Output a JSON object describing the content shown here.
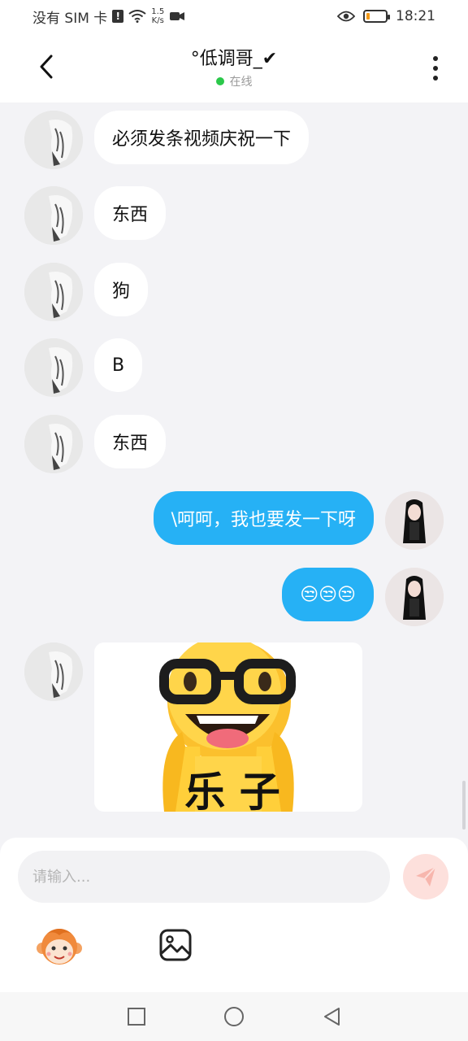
{
  "status_bar": {
    "carrier": "没有 SIM 卡",
    "sim_badge": "!",
    "speed_value": "1.5",
    "speed_unit": "K/s",
    "time": "18:21",
    "battery_level": 0.2
  },
  "header": {
    "title": "°低调哥_✔",
    "status": "在线"
  },
  "messages": [
    {
      "side": "in",
      "text": "必须发条视频庆祝一下"
    },
    {
      "side": "in",
      "text": "东西"
    },
    {
      "side": "in",
      "text": "狗"
    },
    {
      "side": "in",
      "text": "B"
    },
    {
      "side": "in",
      "text": "东西"
    },
    {
      "side": "out",
      "text": "\\呵呵，我也要发一下呀"
    },
    {
      "side": "out",
      "text": "😒😒😒"
    },
    {
      "side": "in",
      "type": "sticker",
      "sticker_text": "乐 子"
    }
  ],
  "input": {
    "placeholder": "请输入..."
  },
  "icons": {
    "back": "back-arrow-icon",
    "more": "more-vertical-icon",
    "send": "send-icon",
    "emoji": "monkey-emoji-icon",
    "image": "image-icon",
    "nav_recent": "square-icon",
    "nav_home": "circle-icon",
    "nav_back": "triangle-back-icon"
  },
  "colors": {
    "outgoing_bubble": "#26b1f5",
    "incoming_bubble": "#ffffff",
    "online_dot": "#2bc84a",
    "send_button": "#fde0dc",
    "background": "#f3f3f6"
  }
}
